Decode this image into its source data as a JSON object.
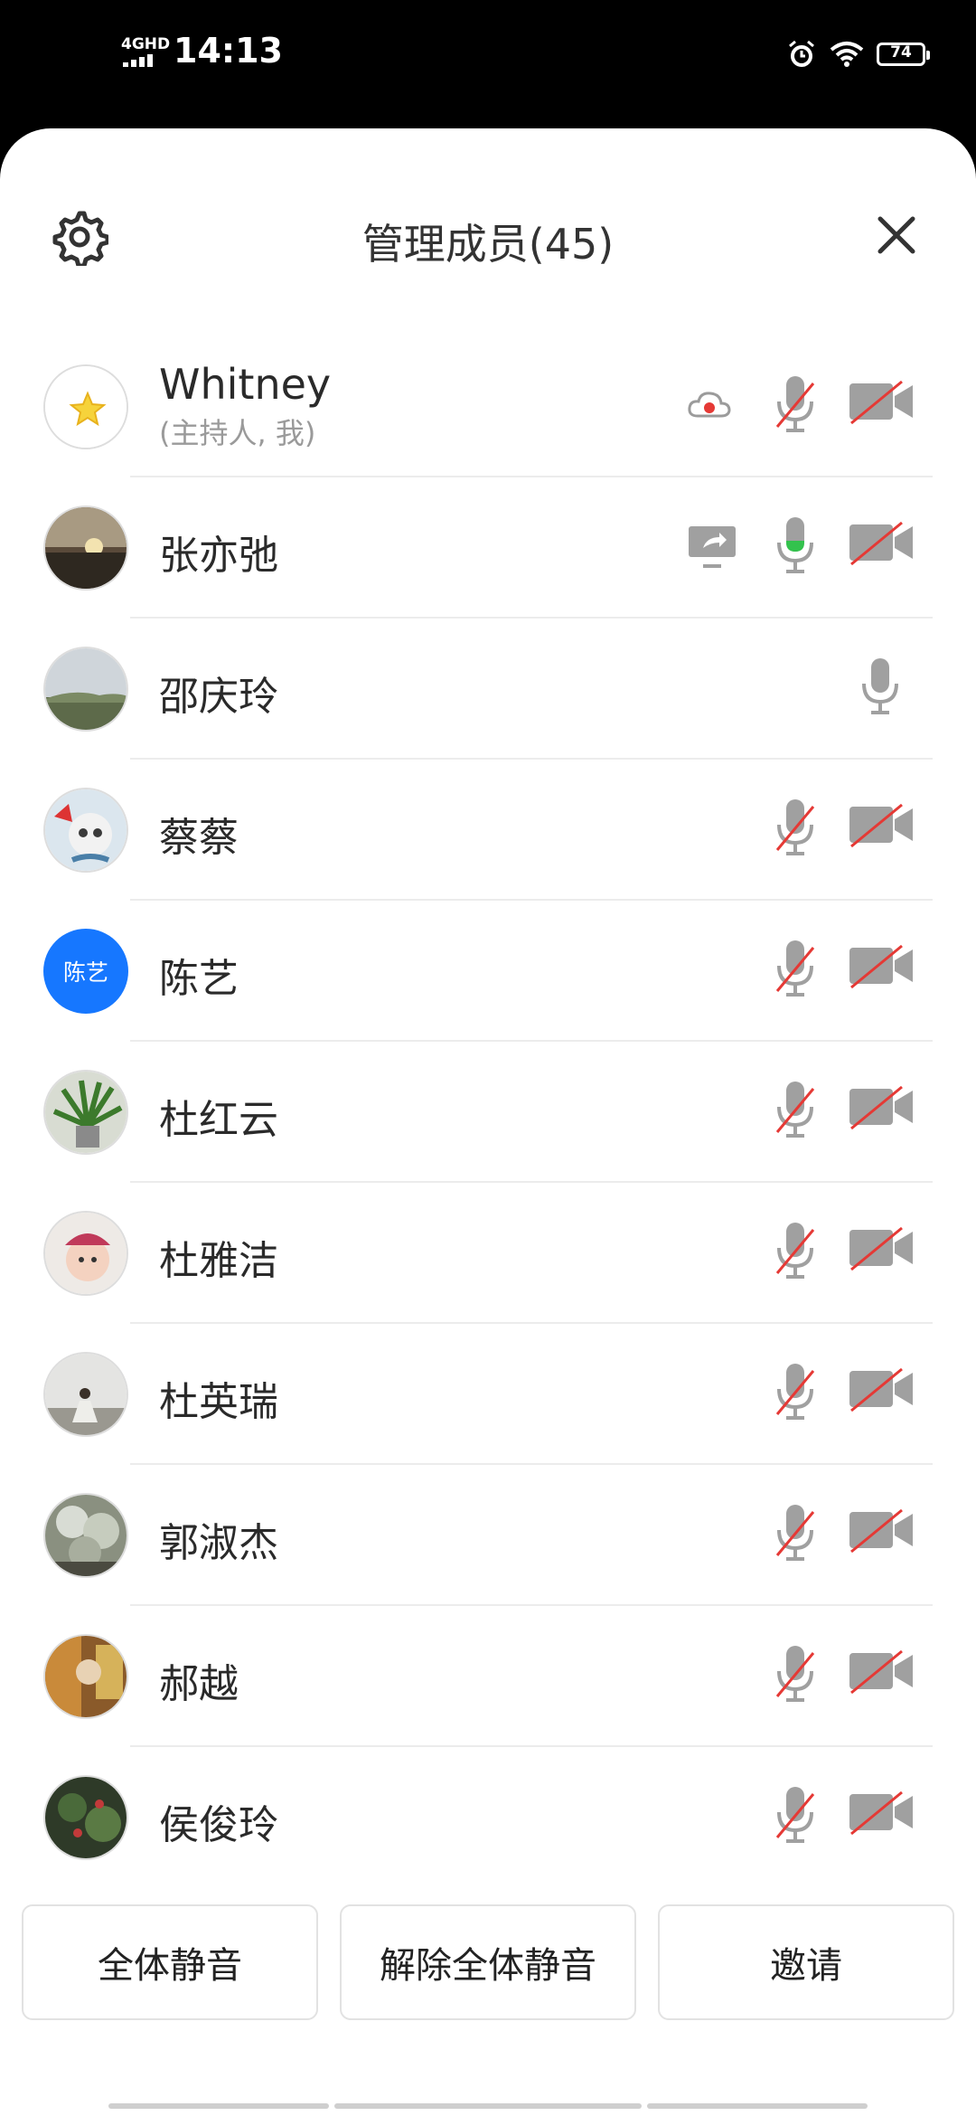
{
  "status_bar": {
    "network": "4GHD",
    "time": "14:13",
    "battery": "74"
  },
  "header": {
    "title": "管理成员(45)"
  },
  "members": [
    {
      "name": "Whitney",
      "subtitle": "(主持人, 我)",
      "avatar": "star-avatar",
      "status": [
        "recording-icon",
        "mic-off-icon",
        "camera-off-icon"
      ]
    },
    {
      "name": "张亦弛",
      "avatar": "sunset-photo",
      "status": [
        "screen-share-icon",
        "mic-on-icon",
        "camera-off-icon"
      ]
    },
    {
      "name": "邵庆玲",
      "avatar": "landscape-photo",
      "status": [
        "mic-icon"
      ]
    },
    {
      "name": "蔡蔡",
      "avatar": "cat-photo",
      "status": [
        "mic-off-icon",
        "camera-off-icon"
      ]
    },
    {
      "name": "陈艺",
      "avatar": "text-avatar",
      "avatar_text": "陈艺",
      "status": [
        "mic-off-icon",
        "camera-off-icon"
      ]
    },
    {
      "name": "杜红云",
      "avatar": "plant-photo",
      "status": [
        "mic-off-icon",
        "camera-off-icon"
      ]
    },
    {
      "name": "杜雅洁",
      "avatar": "baby-photo",
      "status": [
        "mic-off-icon",
        "camera-off-icon"
      ]
    },
    {
      "name": "杜英瑞",
      "avatar": "person-photo",
      "status": [
        "mic-off-icon",
        "camera-off-icon"
      ]
    },
    {
      "name": "郭淑杰",
      "avatar": "tree-photo",
      "status": [
        "mic-off-icon",
        "camera-off-icon"
      ]
    },
    {
      "name": "郝越",
      "avatar": "room-photo",
      "status": [
        "mic-off-icon",
        "camera-off-icon"
      ]
    },
    {
      "name": "侯俊玲",
      "avatar": "garden-photo",
      "status": [
        "mic-off-icon",
        "camera-off-icon"
      ]
    }
  ],
  "footer": {
    "mute_all": "全体静音",
    "unmute_all": "解除全体静音",
    "invite": "邀请"
  },
  "colors": {
    "accent_blue": "#1677ff",
    "record_red": "#e53935",
    "mic_green": "#33c24d",
    "icon_gray": "#9b9b9b"
  }
}
